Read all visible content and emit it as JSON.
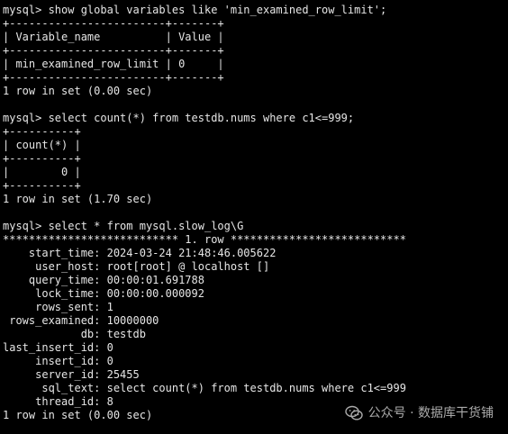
{
  "terminal": {
    "lines": [
      "mysql> show global variables like 'min_examined_row_limit';",
      "+------------------------+-------+",
      "| Variable_name          | Value |",
      "+------------------------+-------+",
      "| min_examined_row_limit | 0     |",
      "+------------------------+-------+",
      "1 row in set (0.00 sec)",
      "",
      "mysql> select count(*) from testdb.nums where c1<=999;",
      "+----------+",
      "| count(*) |",
      "+----------+",
      "|        0 |",
      "+----------+",
      "1 row in set (1.70 sec)",
      "",
      "mysql> select * from mysql.slow_log\\G",
      "*************************** 1. row ***************************",
      "    start_time: 2024-03-24 21:48:46.005622",
      "     user_host: root[root] @ localhost []",
      "    query_time: 00:00:01.691788",
      "     lock_time: 00:00:00.000092",
      "     rows_sent: 1",
      " rows_examined: 10000000",
      "            db: testdb",
      "last_insert_id: 0",
      "     insert_id: 0",
      "     server_id: 25455",
      "      sql_text: select count(*) from testdb.nums where c1<=999",
      "     thread_id: 8",
      "1 row in set (0.00 sec)"
    ]
  },
  "watermark": {
    "icon": "wechat-icon",
    "text": "公众号 · 数据库干货铺"
  }
}
